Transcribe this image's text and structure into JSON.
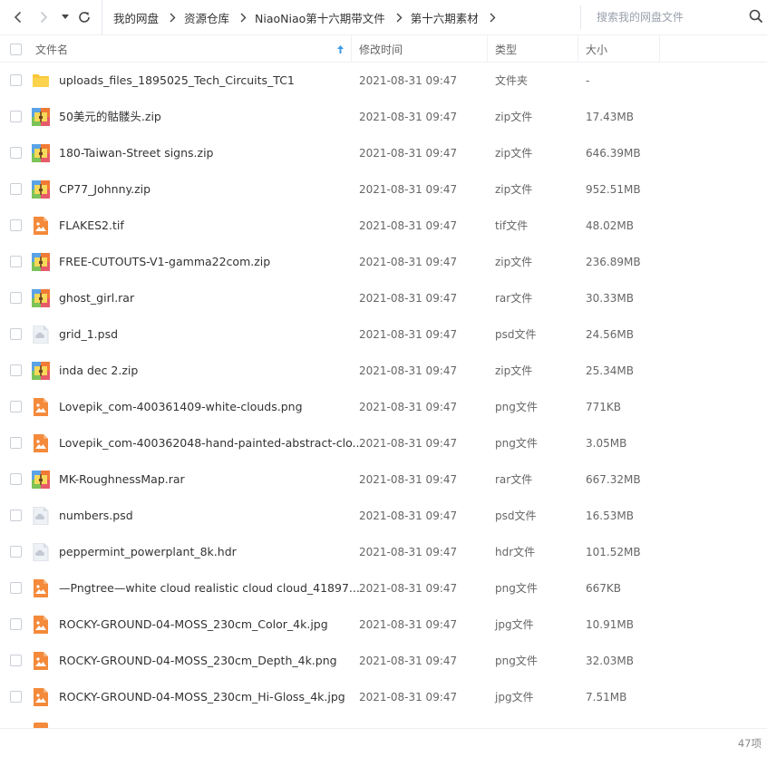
{
  "nav": {
    "back_icon": "chevron-left-icon",
    "forward_icon": "chevron-right-icon",
    "dropdown_icon": "caret-down-icon",
    "refresh_icon": "refresh-icon"
  },
  "breadcrumbs": [
    "我的网盘",
    "资源仓库",
    "NiaoNiao第十六期带文件",
    "第十六期素材"
  ],
  "search": {
    "placeholder": "搜索我的网盘文件",
    "icon": "search-icon"
  },
  "columns": {
    "name": "文件名",
    "sort_icon": "sort-up-arrow-icon",
    "modified": "修改时间",
    "type": "类型",
    "size": "大小"
  },
  "colors": {
    "folder": "#f9c839",
    "archive_a": "#5aa3e6",
    "archive_b": "#f17a36",
    "archive_c": "#7cc359",
    "archive_d": "#e75a6a",
    "image": "#f48a3b",
    "generic": "#d8dde5",
    "accent": "#3a9ae8"
  },
  "files": [
    {
      "name": "uploads_files_1895025_Tech_Circuits_TC1",
      "modified": "2021-08-31 09:47",
      "type": "文件夹",
      "size": "-",
      "icon": "folder-icon"
    },
    {
      "name": "50美元的骷髅头.zip",
      "modified": "2021-08-31 09:47",
      "type": "zip文件",
      "size": "17.43MB",
      "icon": "archive-icon"
    },
    {
      "name": "180-Taiwan-Street signs.zip",
      "modified": "2021-08-31 09:47",
      "type": "zip文件",
      "size": "646.39MB",
      "icon": "archive-icon"
    },
    {
      "name": "CP77_Johnny.zip",
      "modified": "2021-08-31 09:47",
      "type": "zip文件",
      "size": "952.51MB",
      "icon": "archive-icon"
    },
    {
      "name": "FLAKES2.tif",
      "modified": "2021-08-31 09:47",
      "type": "tif文件",
      "size": "48.02MB",
      "icon": "image-file-icon"
    },
    {
      "name": "FREE-CUTOUTS-V1-gamma22com.zip",
      "modified": "2021-08-31 09:47",
      "type": "zip文件",
      "size": "236.89MB",
      "icon": "archive-icon"
    },
    {
      "name": "ghost_girl.rar",
      "modified": "2021-08-31 09:47",
      "type": "rar文件",
      "size": "30.33MB",
      "icon": "archive-icon"
    },
    {
      "name": "grid_1.psd",
      "modified": "2021-08-31 09:47",
      "type": "psd文件",
      "size": "24.56MB",
      "icon": "generic-file-icon"
    },
    {
      "name": "inda dec 2.zip",
      "modified": "2021-08-31 09:47",
      "type": "zip文件",
      "size": "25.34MB",
      "icon": "archive-icon"
    },
    {
      "name": "Lovepik_com-400361409-white-clouds.png",
      "modified": "2021-08-31 09:47",
      "type": "png文件",
      "size": "771KB",
      "icon": "image-file-icon"
    },
    {
      "name": "Lovepik_com-400362048-hand-painted-abstract-clo...",
      "modified": "2021-08-31 09:47",
      "type": "png文件",
      "size": "3.05MB",
      "icon": "image-file-icon"
    },
    {
      "name": "MK-RoughnessMap.rar",
      "modified": "2021-08-31 09:47",
      "type": "rar文件",
      "size": "667.32MB",
      "icon": "archive-icon"
    },
    {
      "name": "numbers.psd",
      "modified": "2021-08-31 09:47",
      "type": "psd文件",
      "size": "16.53MB",
      "icon": "generic-file-icon"
    },
    {
      "name": "peppermint_powerplant_8k.hdr",
      "modified": "2021-08-31 09:47",
      "type": "hdr文件",
      "size": "101.52MB",
      "icon": "generic-file-icon"
    },
    {
      "name": "—Pngtree—white cloud realistic cloud cloud_41897...",
      "modified": "2021-08-31 09:47",
      "type": "png文件",
      "size": "667KB",
      "icon": "image-file-icon"
    },
    {
      "name": "ROCKY-GROUND-04-MOSS_230cm_Color_4k.jpg",
      "modified": "2021-08-31 09:47",
      "type": "jpg文件",
      "size": "10.91MB",
      "icon": "image-file-icon"
    },
    {
      "name": "ROCKY-GROUND-04-MOSS_230cm_Depth_4k.png",
      "modified": "2021-08-31 09:47",
      "type": "png文件",
      "size": "32.03MB",
      "icon": "image-file-icon"
    },
    {
      "name": "ROCKY-GROUND-04-MOSS_230cm_Hi-Gloss_4k.jpg",
      "modified": "2021-08-31 09:47",
      "type": "jpg文件",
      "size": "7.51MB",
      "icon": "image-file-icon"
    }
  ],
  "status": {
    "count": "47项"
  }
}
